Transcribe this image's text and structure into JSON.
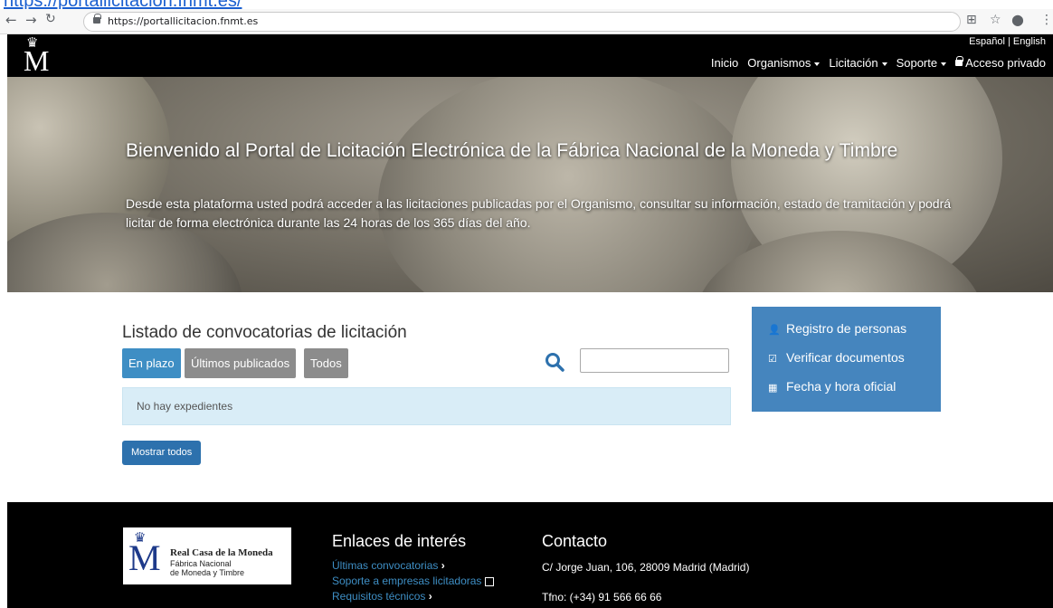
{
  "browser": {
    "top_link": "https://portallicitacion.fnmt.es/",
    "url": "https://portallicitacion.fnmt.es",
    "back_icon": "arrow-left-icon",
    "forward_icon": "arrow-right-icon",
    "reload_icon": "reload-icon"
  },
  "header": {
    "lang_es": "Español",
    "lang_sep": "|",
    "lang_en": "English",
    "nav": {
      "inicio": "Inicio",
      "organismos": "Organismos",
      "licitacion": "Licitación",
      "soporte": "Soporte",
      "acceso": "Acceso privado"
    },
    "logo_letter": "M"
  },
  "hero": {
    "title": "Bienvenido al Portal de Licitación Electrónica de la Fábrica Nacional de la Moneda y Timbre",
    "subtitle": "Desde esta plataforma usted podrá acceder a las licitaciones publicadas por el Organismo, consultar su información, estado de tramitación y podrá licitar de forma electrónica durante las 24 horas de los 365 días del año."
  },
  "main": {
    "list_title": "Listado de convocatorias de licitación",
    "tabs": [
      {
        "label": "En plazo",
        "active": true
      },
      {
        "label": "Últimos publicados",
        "active": false
      },
      {
        "label": "Todos",
        "active": false
      }
    ],
    "search_value": "",
    "empty_message": "No hay expedientes",
    "show_all_label": "Mostrar todos"
  },
  "side_panel": {
    "items": [
      {
        "label": "Registro de personas",
        "icon": "user-icon"
      },
      {
        "label": "Verificar documentos",
        "icon": "checkbox-icon"
      },
      {
        "label": "Fecha y hora oficial",
        "icon": "calendar-icon"
      }
    ]
  },
  "footer": {
    "logo_name": "Real Casa de la Moneda",
    "logo_sub1": "Fábrica Nacional",
    "logo_sub2": "de Moneda y Timbre",
    "links_title": "Enlaces de interés",
    "links": [
      "Últimas convocatorias",
      "Soporte a empresas licitadoras",
      "Requisitos técnicos"
    ],
    "contact_title": "Contacto",
    "address": "C/ Jorge Juan, 106, 28009 Madrid (Madrid)",
    "phone": "Tfno: (+34) 91 566 66 66"
  },
  "colors": {
    "primary": "#3e8ec4",
    "side_panel": "#4585be",
    "alert_bg": "#d9edf7",
    "header_bg": "#000000"
  }
}
